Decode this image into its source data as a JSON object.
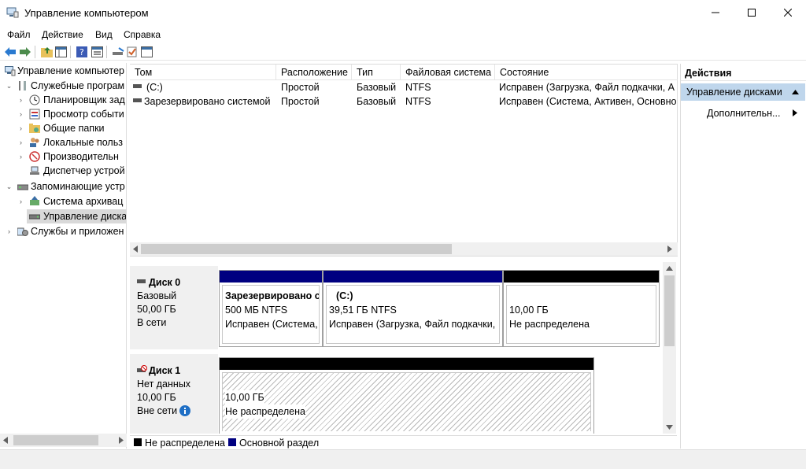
{
  "window": {
    "title": "Управление компьютером"
  },
  "menu": [
    "Файл",
    "Действие",
    "Вид",
    "Справка"
  ],
  "tree": [
    {
      "label": "Управление компьютер",
      "icon": "computer-management-icon"
    },
    {
      "label": "Служебные програм",
      "icon": "tools-icon"
    },
    {
      "label": "Планировщик зад",
      "icon": "clock-icon"
    },
    {
      "label": "Просмотр событи",
      "icon": "event-viewer-icon"
    },
    {
      "label": "Общие папки",
      "icon": "shared-folder-icon"
    },
    {
      "label": "Локальные польз",
      "icon": "users-icon"
    },
    {
      "label": "Производительн",
      "icon": "performance-icon"
    },
    {
      "label": "Диспетчер устрой",
      "icon": "device-manager-icon"
    },
    {
      "label": "Запоминающие устр",
      "icon": "storage-icon"
    },
    {
      "label": "Система архивац",
      "icon": "backup-icon"
    },
    {
      "label": "Управление диска",
      "icon": "disk-icon"
    },
    {
      "label": "Службы и приложен",
      "icon": "services-icon"
    }
  ],
  "volumes": {
    "columns": [
      "Том",
      "Расположение",
      "Тип",
      "Файловая система",
      "Состояние"
    ],
    "rows": [
      {
        "name": "(C:)",
        "layout": "Простой",
        "type": "Базовый",
        "fs": "NTFS",
        "status": "Исправен (Загрузка, Файл подкачки, А"
      },
      {
        "name": "Зарезервировано системой",
        "layout": "Простой",
        "type": "Базовый",
        "fs": "NTFS",
        "status": "Исправен (Система, Активен, Основно"
      }
    ]
  },
  "disks": [
    {
      "name": "Диск 0",
      "type": "Базовый",
      "size": "50,00 ГБ",
      "state": "В сети",
      "partitions": [
        {
          "title": "Зарезервировано си",
          "size": "500 МБ NTFS",
          "status": "Исправен (Система,",
          "bar_color": "#000080"
        },
        {
          "title": "(C:)",
          "size": "39,51 ГБ NTFS",
          "status": "Исправен (Загрузка, Файл подкачки,",
          "bar_color": "#000080"
        },
        {
          "title": "",
          "size": "10,00 ГБ",
          "status": "Не распределена",
          "bar_color": "#000000"
        }
      ]
    },
    {
      "name": "Диск 1",
      "type": "Нет данных",
      "size": "10,00 ГБ",
      "state": "Вне сети",
      "partitions": [
        {
          "title": "",
          "size": "10,00 ГБ",
          "status": "Не распределена",
          "bar_color": "#000000"
        }
      ]
    }
  ],
  "legend": [
    {
      "label": "Не распределена",
      "color": "#000000"
    },
    {
      "label": "Основной раздел",
      "color": "#000080"
    }
  ],
  "actions": {
    "header": "Действия",
    "section": "Управление дисками",
    "more": "Дополнительн..."
  }
}
